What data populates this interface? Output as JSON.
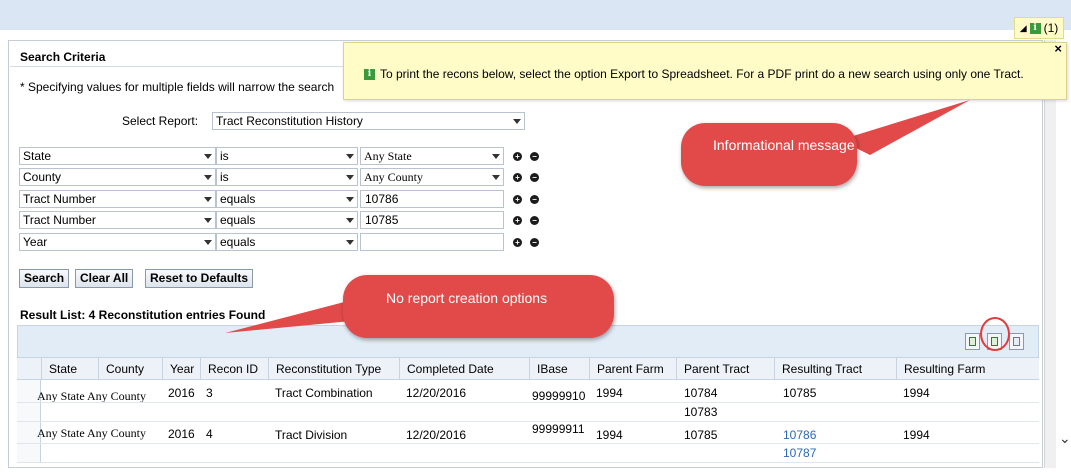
{
  "message_indicator": {
    "count": "(1)"
  },
  "search_criteria": {
    "title": "Search Criteria",
    "hint": "* Specifying values for multiple fields will narrow the search",
    "select_report_label": "Select Report:",
    "select_report_value": "Tract Reconstitution History",
    "rows": [
      {
        "field": "State",
        "operator": "is",
        "value": "Any State"
      },
      {
        "field": "County",
        "operator": "is",
        "value": "Any County"
      },
      {
        "field": "Tract Number",
        "operator": "equals",
        "value": "10786"
      },
      {
        "field": "Tract Number",
        "operator": "equals",
        "value": "10785"
      },
      {
        "field": "Year",
        "operator": "equals",
        "value": ""
      }
    ],
    "buttons": {
      "search": "Search",
      "clear_all": "Clear All",
      "reset": "Reset to Defaults"
    }
  },
  "tooltip": {
    "text": "To print the recons below, select the option Export to Spreadsheet. For a PDF print do a new search using only one Tract.",
    "close": "×"
  },
  "result_list": {
    "title": "Result List: 4 Reconstitution entries Found",
    "columns": [
      "State",
      "County",
      "Year",
      "Recon ID",
      "Reconstitution Type",
      "Completed Date",
      "IBase",
      "Parent Farm",
      "Parent Tract",
      "Resulting Tract",
      "Resulting Farm"
    ],
    "rows": [
      {
        "state_county": "Any State Any County",
        "year": "2016",
        "recon_id": "3",
        "type": "Tract Combination",
        "completed_date": "12/20/2016",
        "ibase": "99999910",
        "parent_farm": "1994",
        "parent_tract": "10784",
        "resulting_tract": "10785",
        "resulting_farm": "1994"
      },
      {
        "parent_tract": "10783"
      },
      {
        "state_county": "Any State Any County",
        "year": "2016",
        "recon_id": "4",
        "type": "Tract Division",
        "completed_date": "12/20/2016",
        "ibase": "99999911",
        "parent_farm": "1994",
        "parent_tract": "10785",
        "resulting_tract": "10786",
        "resulting_farm": "1994"
      },
      {
        "resulting_tract": "10787"
      }
    ]
  },
  "callouts": {
    "info": "Informational message",
    "no_report": "No report creation options"
  },
  "colors": {
    "callout": "#e24a4a",
    "tooltip_bg": "#fffcc8",
    "link": "#2b68b8",
    "header_bg": "#dbe6f4"
  }
}
